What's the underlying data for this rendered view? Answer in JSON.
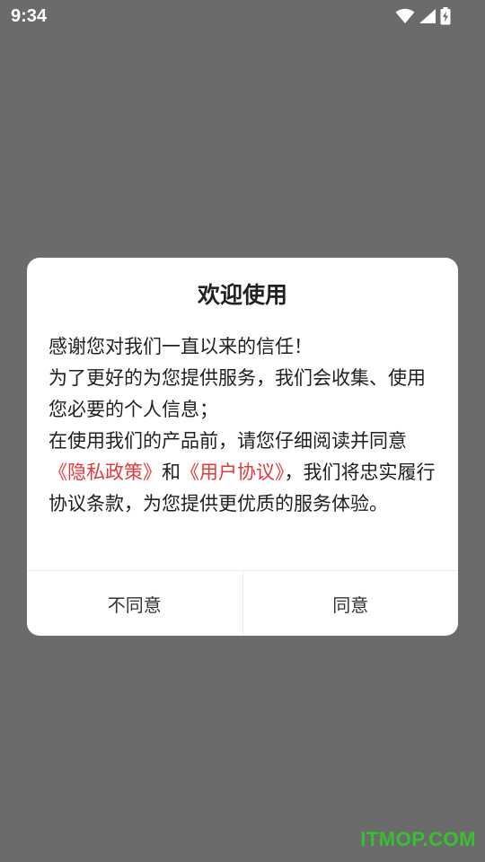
{
  "status_bar": {
    "time": "9:34",
    "icons": [
      "wifi-icon",
      "signal-icon",
      "battery-charging-icon"
    ],
    "color": "#ffffff"
  },
  "dialog": {
    "title": "欢迎使用",
    "line1": "感谢您对我们一直以来的信任！",
    "line2": "为了更好的为您提供服务，我们会收集、使用您必要的个人信息；",
    "line3_prefix": "在使用我们的产品前，请您仔细阅读并同意",
    "privacy_link": "《隐私政策》",
    "and_text": "和",
    "user_link": "《用户协议》",
    "line3_suffix": "，我们将忠实履行协议条款，为您提供更优质的服务体验。",
    "link_color": "#e8373c",
    "buttons": {
      "disagree": "不同意",
      "agree": "同意"
    }
  },
  "watermark": "ITMOP.COM",
  "colors": {
    "overlay": "#6b6b6b",
    "dialog_background": "#ffffff",
    "watermark": "#34c22f"
  }
}
